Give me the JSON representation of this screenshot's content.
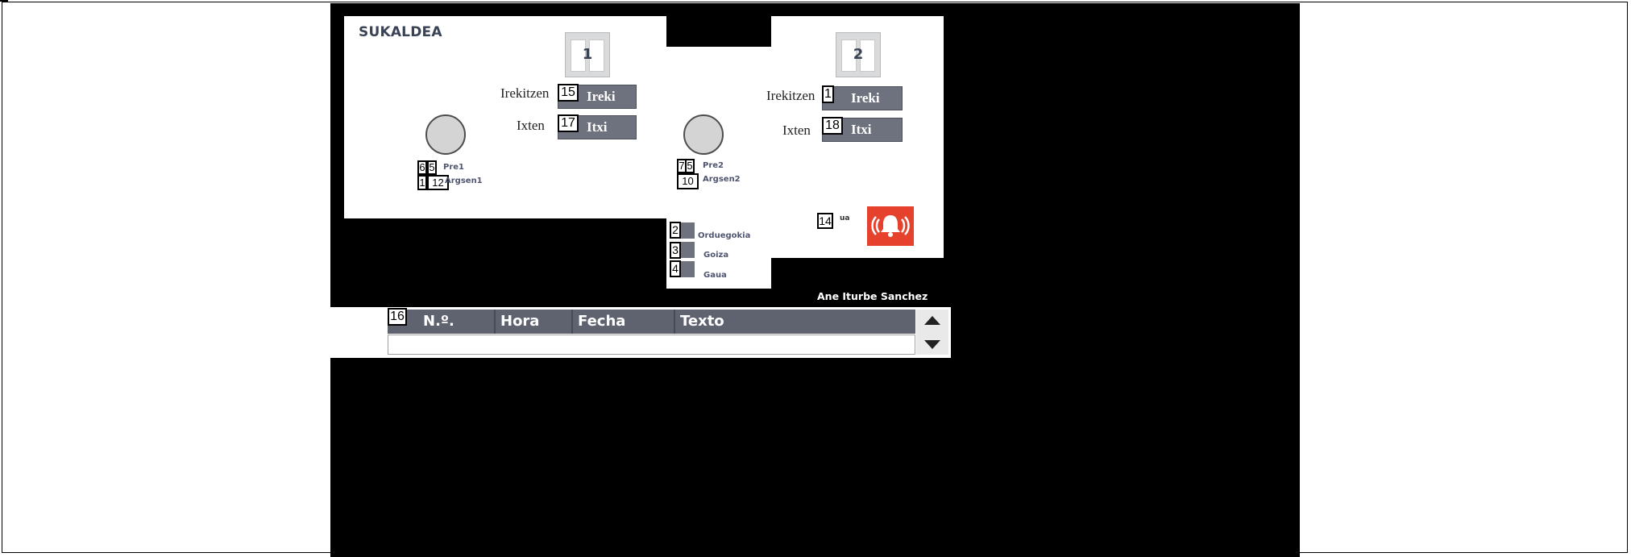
{
  "room_title": "SUKALDEA",
  "windows": [
    {
      "number": "1",
      "open_label": "Irekitzen",
      "open_id": "15",
      "open_button": "Ireki",
      "close_label": "Ixten",
      "close_id": "17",
      "close_button": "Itxi"
    },
    {
      "number": "2",
      "open_label": "Irekitzen",
      "open_id": "1",
      "open_button": "Ireki",
      "close_label": "Ixten",
      "close_id": "18",
      "close_button": "Itxi"
    }
  ],
  "sensors": [
    {
      "id_a": "6",
      "id_b": "5",
      "label_a": "Pre1",
      "id_c": "1",
      "id_d": "12",
      "label_b": "Argsen1"
    },
    {
      "id_a": "7",
      "id_b": "5",
      "label_a": "Pre2",
      "id_c": "10",
      "label_b": "Argsen2"
    }
  ],
  "modes": [
    {
      "id": "2",
      "label": "Orduegokia"
    },
    {
      "id": "3",
      "label": "Goiza"
    },
    {
      "id": "4",
      "label": "Gaua"
    }
  ],
  "alarm": {
    "id": "14",
    "label_fragment": "ua",
    "icon": "alarm-bell-icon",
    "color": "#e6412d"
  },
  "author": "Ane Iturbe Sanchez",
  "alarm_table": {
    "id": "16",
    "columns": [
      "N.º.",
      "Hora",
      "Fecha",
      "Texto"
    ]
  },
  "colors": {
    "button": "#6e727e",
    "title": "#3a4256",
    "header": "#5e636f"
  }
}
